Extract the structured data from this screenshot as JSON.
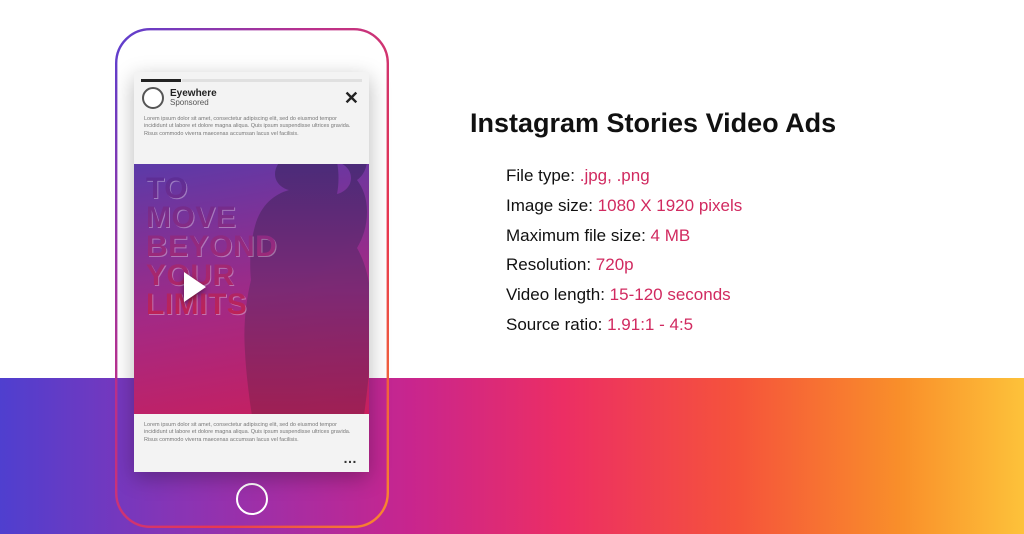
{
  "title": "Instagram Stories Video Ads",
  "specs": [
    {
      "label": "File type:",
      "value": ".jpg, .png"
    },
    {
      "label": "Image size:",
      "value": "1080 X 1920 pixels"
    },
    {
      "label": "Maximum file size:",
      "value": "4 MB"
    },
    {
      "label": "Resolution:",
      "value": "720p"
    },
    {
      "label": "Video length:",
      "value": "15-120 seconds"
    },
    {
      "label": "Source ratio:",
      "value": "1.91:1 - 4:5"
    }
  ],
  "story": {
    "brand": "Eyewhere",
    "sponsored": "Sponsored",
    "lorem_top": "Lorem ipsum dolor sit amet, consectetur adipiscing elit, sed do eiusmod tempor incididunt ut labore et dolore magna aliqua. Quis ipsum suspendisse ultrices gravida. Risus commodo viverra maecenas accumsan lacus vel facilisis.",
    "headline": "TO\nMOVE\nBEYOND\nYOUR\nLIMITS",
    "lorem_bottom": "Lorem ipsum dolor sit amet, consectetur adipiscing elit, sed do eiusmod tempor incididunt ut labore et dolore magna aliqua. Quis ipsum suspendisse ultrices gravida. Risus commodo viverra maecenas accumsan lacus vel facilisis.",
    "ellipsis": "…"
  }
}
